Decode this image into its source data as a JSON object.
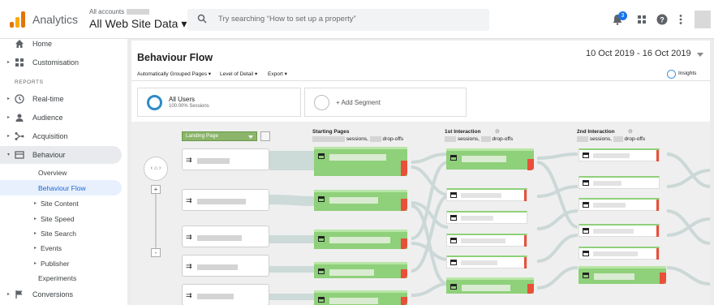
{
  "topbar": {
    "app_name": "Analytics",
    "account_label": "All accounts",
    "property": "All Web Site Data ▾",
    "search_placeholder": "Try searching “How to set up a property”",
    "notification_count": "3"
  },
  "sidebar": {
    "items_top": [
      {
        "label": "Home",
        "icon": "home-icon"
      },
      {
        "label": "Customisation",
        "icon": "customisation-icon"
      }
    ],
    "reports_label": "REPORTS",
    "items": [
      {
        "label": "Real-time",
        "icon": "clock-icon"
      },
      {
        "label": "Audience",
        "icon": "person-icon"
      },
      {
        "label": "Acquisition",
        "icon": "acquisition-icon"
      },
      {
        "label": "Behaviour",
        "icon": "behaviour-icon"
      }
    ],
    "behaviour_sub": [
      {
        "label": "Overview"
      },
      {
        "label": "Behaviour Flow"
      },
      {
        "label": "Site Content"
      },
      {
        "label": "Site Speed"
      },
      {
        "label": "Site Search"
      },
      {
        "label": "Events"
      },
      {
        "label": "Publisher"
      },
      {
        "label": "Experiments"
      }
    ],
    "conversions": "Conversions"
  },
  "main": {
    "title": "Behaviour Flow",
    "date_range": "10 Oct 2019 - 16 Oct 2019",
    "controls": {
      "grouped": "Automatically Grouped Pages ▾",
      "detail": "Level of Detail ▾",
      "export": "Export ▾",
      "insights": "Insights"
    },
    "segments": {
      "all_users": "All Users",
      "all_users_sub": "100.00% Sessions",
      "add": "+ Add Segment"
    },
    "flow": {
      "landing_dropdown": "Landing Page",
      "col1_title": "Starting Pages",
      "col2_title": "1st Interaction",
      "col3_title": "2nd Interaction",
      "sessions_word": "sessions,",
      "dropoffs_word": "drop-offs",
      "zoom_in": "+",
      "zoom_out": "-"
    }
  },
  "colors": {
    "accent": "#1a73e8",
    "node_green": "#8fd07a",
    "dropoff_red": "#e8503a",
    "landing_green": "#8bb56a"
  }
}
